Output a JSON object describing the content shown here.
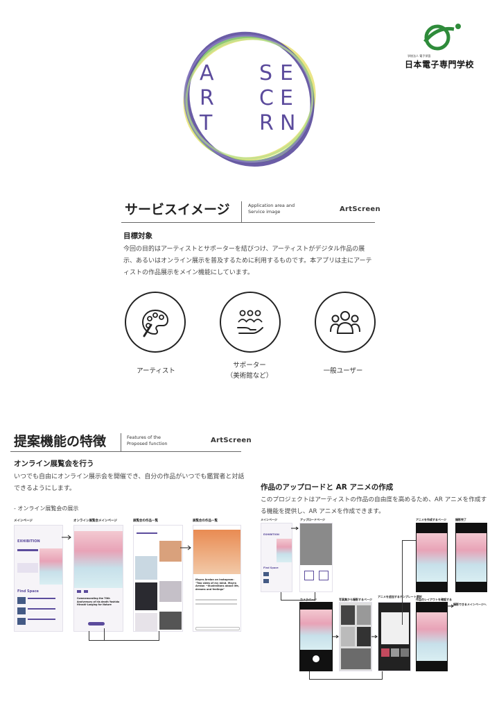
{
  "logo": {
    "letters": [
      "A",
      "R",
      "T",
      "S",
      "E",
      "C",
      "R",
      "E",
      "E",
      "E",
      "R",
      "N"
    ],
    "brand_color": "#5b4b9c",
    "ring_colors": [
      "#5b4b9c",
      "#7fc26a",
      "#e9e27a"
    ]
  },
  "school": {
    "name": "日本電子専門学校",
    "sub": "学校法人 電子学園",
    "logo_color": "#2e8b3a"
  },
  "service_section": {
    "title": "サービスイメージ",
    "en_label_1": "Application area and",
    "en_label_2": "Service image",
    "brand": "ArtScreen",
    "goal_heading": "目標対象",
    "goal_text": "今回の目的はアーティストとサポーターを結びつけ、アーティストがデジタル作品の展示、あるいはオンライン展示を普及するために利用するものです。本アプリは主にアーティストの作品展示をメイン機能にしています。",
    "targets": [
      {
        "icon": "palette-icon",
        "label": "アーティスト",
        "label2": ""
      },
      {
        "icon": "supporters-icon",
        "label": "サポーター",
        "label2": "（美術館など）"
      },
      {
        "icon": "users-icon",
        "label": "一般ユーザー",
        "label2": ""
      }
    ]
  },
  "features_section": {
    "title": "提案機能の特徴",
    "en_label_1": "Features of the",
    "en_label_2": "Proposed function",
    "brand": "ArtScreen",
    "online_heading": "オンライン展覧会を行う",
    "online_text": "いつでも自由にオンライン展示会を開催でき、自分の作品がいつでも鑑賞者と対話できるようにします。",
    "online_caption": "- オンライン展覧会の展示",
    "screens_left": [
      "メインページ",
      "オンライン展覧会メインページ",
      "展覧会の作品一覧",
      "展覧会の作品一覧"
    ],
    "upload_heading": "作品のアップロードと AR アニメの作成",
    "upload_text": "このプロジェクトはアーティストの作品の自由度を高めるため、AR アニメを作成する機能を提供し、AR アニメを作成できます。",
    "screens_right_top": [
      "メインページ",
      "アップロードページ",
      "アニメを作成するページ",
      "撮影完了"
    ],
    "screens_right_bottom": [
      "カメラページ",
      "写真集から撮影するページ",
      "アニメを追加するテンプレート選択",
      "作品のレイアウトを確認する"
    ],
    "right_note": "撮影できるメインページへ"
  },
  "mockup_text": {
    "exhibition": "EXHIBITION",
    "find_space": "Find Space",
    "museum": "ROA MUSEUM OF ART",
    "commemorating": "Commemorating the 70th Anniversary of his death Yoshida Hiroshi-Longing for Nature",
    "mayra": "Mayra Arrdan on Instagram: \"Two sides of my mind. Mayra Arrdan ~Illustrations about life, dreams and feelings\"",
    "apply": "APPLY"
  }
}
